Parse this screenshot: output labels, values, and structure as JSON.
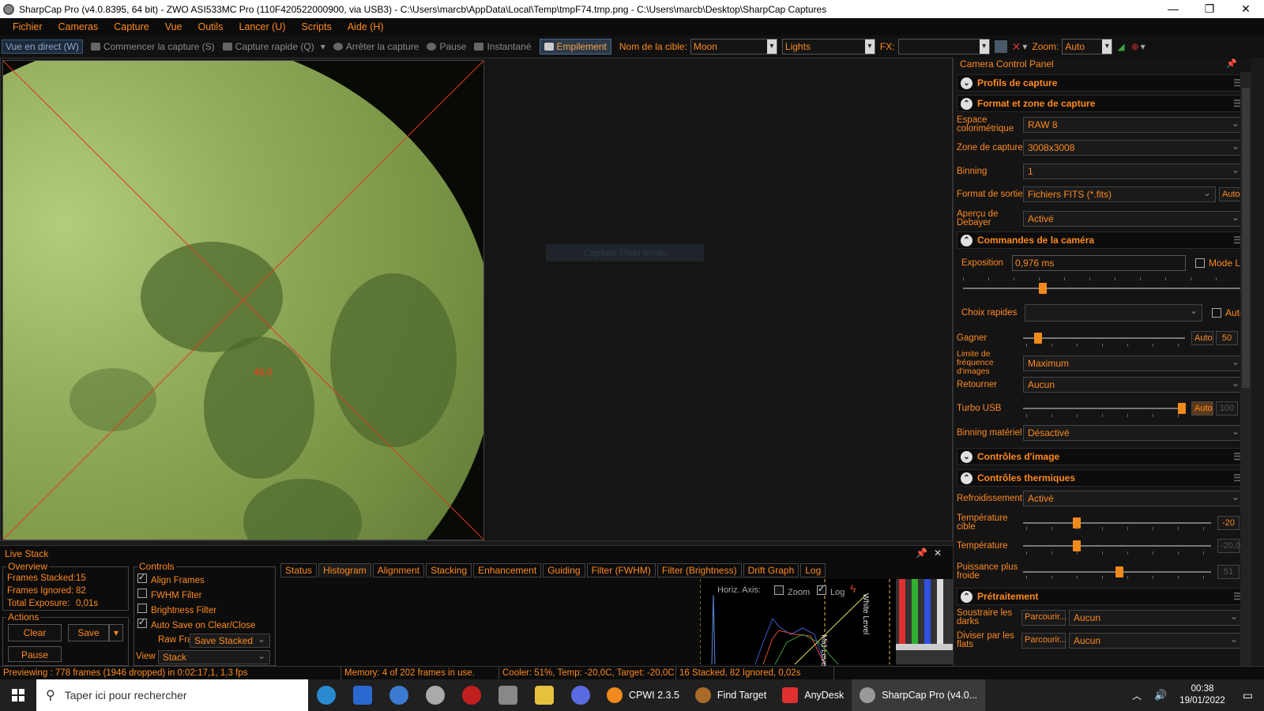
{
  "window": {
    "title": "SharpCap Pro (v4.0.8395, 64 bit) - ZWO ASI533MC Pro (110F420522000900, via USB3) - C:\\Users\\marcb\\AppData\\Local\\Temp\\tmpF74.tmp.png - C:\\Users\\marcb\\Desktop\\SharpCap Captures",
    "minimize": "—",
    "maximize": "❐",
    "close": "✕"
  },
  "menu": [
    "Fichier",
    "Cameras",
    "Capture",
    "Vue",
    "Outils",
    "Lancer (U)",
    "Scripts",
    "Aide (H)"
  ],
  "toolbar": {
    "live": "Vue en direct (W)",
    "start_capture": "Commencer la capture (S)",
    "quick_capture": "Capture rapide (Q)",
    "stop_capture": "Arrêter la capture",
    "pause": "Pause",
    "snapshot": "Instantané",
    "stacking": "Empilement",
    "target_label": "Nom de la cible:",
    "target_value": "Moon",
    "frame_type": "Lights",
    "fx_label": "FX:",
    "fx_value": "",
    "zoom_label": "Zoom:",
    "zoom_value": "Auto"
  },
  "viewport": {
    "angle_label": "46,0",
    "fullscreen_hint": "Capture Plein écran"
  },
  "panel": {
    "title": "Camera Control Panel",
    "sections": {
      "profiles": "Profils de capture",
      "format": "Format et zone de capture",
      "camera": "Commandes de la caméra",
      "image": "Contrôles d'image",
      "thermal": "Contrôles thermiques",
      "preproc": "Prétraitement"
    },
    "colorspace_label": "Espace colorimétrique",
    "colorspace_value": "RAW 8",
    "zone_label": "Zone de capture",
    "zone_value": "3008x3008",
    "binning_label": "Binning",
    "binning_value": "1",
    "output_label": "Format de sortie",
    "output_value": "Fichiers FITS (*.fits)",
    "output_auto": "Auto",
    "debayer_label": "Aperçu de Debayer",
    "debayer_value": "Activé",
    "exposure_label": "Exposition",
    "exposure_value": "0,976 ms",
    "modelx_label": "Mode LX",
    "quick_label": "Choix rapides",
    "quick_auto": "Auto",
    "gain_label": "Gagner",
    "gain_auto": "Auto",
    "gain_value": "50",
    "framerate_label": "Limite de fréquence d'images",
    "framerate_value": "Maximum",
    "flip_label": "Retourner",
    "flip_value": "Aucun",
    "turbo_label": "Turbo USB",
    "turbo_auto": "Auto",
    "turbo_value": "100",
    "hwbin_label": "Binning matériel",
    "hwbin_value": "Désactivé",
    "cooling_label": "Refroidissement",
    "cooling_value": "Activé",
    "target_temp_label": "Température cible",
    "target_temp_value": "-20",
    "temp_label": "Température",
    "temp_value": "-20,0",
    "coldpower_label": "Puissance plus froide",
    "coldpower_value": "51",
    "darks_label": "Soustraire les darks",
    "browse1": "Parcourir...",
    "darks_value": "Aucun",
    "flats_label": "Diviser par les flats",
    "browse2": "Parcourir...",
    "flats_value": "Aucun"
  },
  "livestack": {
    "title": "Live Stack",
    "overview": "Overview",
    "frames_stacked_label": "Frames Stacked:",
    "frames_stacked": "15",
    "frames_ignored_label": "Frames Ignored:",
    "frames_ignored": "82",
    "total_exposure_label": "Total Exposure:",
    "total_exposure": "0,01s",
    "actions": "Actions",
    "clear": "Clear",
    "save": "Save",
    "pause": "Pause",
    "controls": "Controls",
    "align": "Align Frames",
    "fwhm": "FWHM Filter",
    "brightness": "Brightness Filter",
    "autosave": "Auto Save on Clear/Close",
    "raw_label": "Raw Frames",
    "raw_value": "Save Stacked",
    "view_label": "View",
    "view_value": "Stack",
    "tabs": [
      "Status",
      "Histogram",
      "Alignment",
      "Stacking",
      "Enhancement",
      "Guiding",
      "Filter (FWHM)",
      "Filter (Brightness)",
      "Drift Graph",
      "Log"
    ],
    "horiz_axis": "Horiz. Axis:",
    "zoom": "Zoom",
    "log": "Log",
    "white_level": "White Level",
    "mid_level": "Mid Level"
  },
  "status": {
    "preview": "Previewing : 778 frames (1946 dropped) in 0:02:17,1, 1,3 fps",
    "memory": "Memory: 4 of 202 frames in use.",
    "cooler": "Cooler: 51%, Temp: -20,0C, Target: -20,0C",
    "stacked": "16 Stacked, 82 Ignored, 0,02s"
  },
  "taskbar": {
    "search": "Taper ici pour rechercher",
    "apps": [
      "CPWI 2.3.5",
      "Find Target",
      "AnyDesk",
      "SharpCap Pro (v4.0..."
    ],
    "time": "00:38",
    "date": "19/01/2022"
  }
}
